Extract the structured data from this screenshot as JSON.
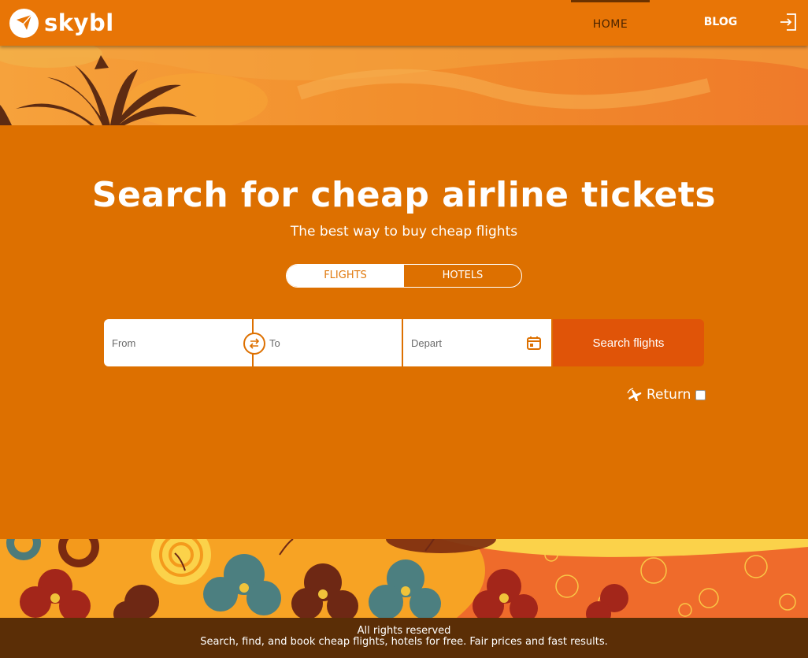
{
  "header": {
    "logo_text": "skybl",
    "nav": {
      "home": "HOME",
      "blog": "BLOG"
    }
  },
  "hero": {
    "title": "Search for cheap airline tickets",
    "subtitle": "The best way to buy cheap flights"
  },
  "tabs": {
    "flights": "FLIGHTS",
    "hotels": "HOTELS",
    "active": "flights"
  },
  "search": {
    "from_placeholder": "From",
    "to_placeholder": "To",
    "depart_placeholder": "Depart",
    "button_label": "Search flights",
    "return_label": "Return",
    "return_checked": false
  },
  "footer": {
    "line1": "All rights reserved",
    "line2": "Search, find, and book cheap flights, hotels for free. Fair prices and fast results."
  },
  "colors": {
    "accent": "#e87506",
    "background": "#dd7000",
    "button": "#e05408",
    "footer": "#5b2e06"
  },
  "icons": {
    "logo": "bird-logo-icon",
    "login": "login-icon",
    "swap": "swap-arrows-icon",
    "calendar": "calendar-icon",
    "return": "plane-return-icon"
  }
}
